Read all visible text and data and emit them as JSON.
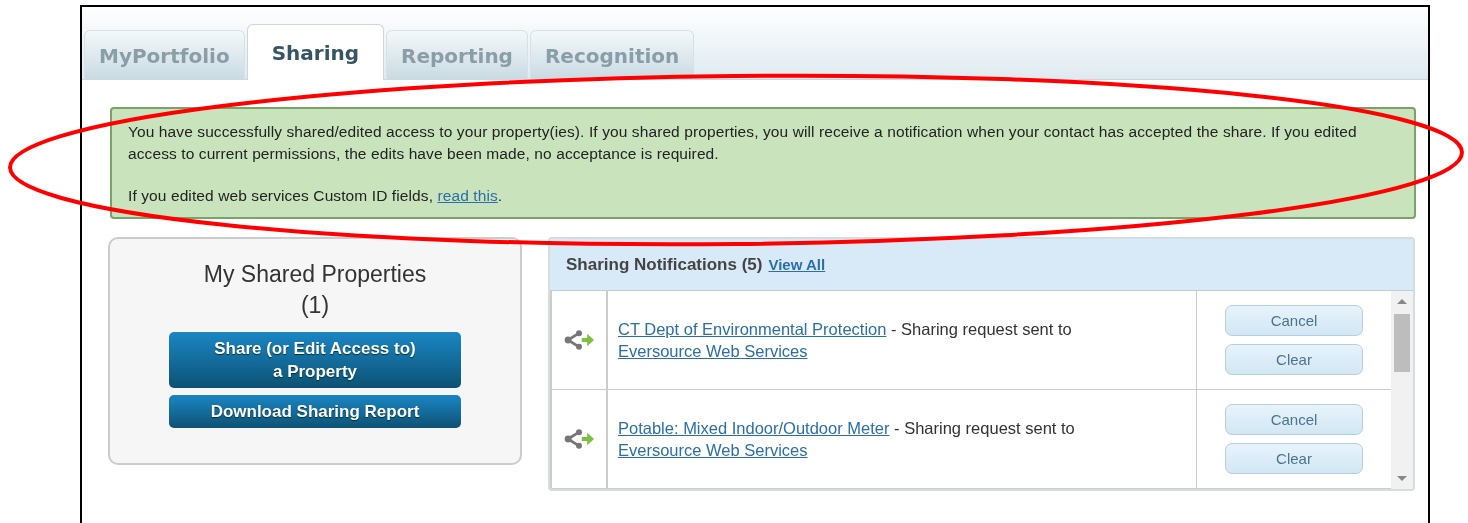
{
  "tabs": [
    {
      "label": "MyPortfolio",
      "selected": false
    },
    {
      "label": "Sharing",
      "selected": true
    },
    {
      "label": "Reporting",
      "selected": false
    },
    {
      "label": "Recognition",
      "selected": false
    }
  ],
  "alert": {
    "message": "You have successfully shared/edited access to your property(ies). If you shared properties, you will receive a notification when your contact has accepted the share. If you edited access to current permissions, the edits have been made, no acceptance is required.",
    "note_before": "If you edited web services Custom ID fields,",
    "note_link": "read this",
    "note_after": "."
  },
  "shared_properties": {
    "title": "My Shared Properties",
    "count": "(1)",
    "buttons": [
      {
        "line1": "Share (or Edit Access to)",
        "line2": "a Property"
      },
      {
        "line1": "Download Sharing Report"
      }
    ]
  },
  "notifications": {
    "title": "Sharing Notifications (5)",
    "view_all": "View All",
    "rows": [
      {
        "property": "CT Dept of Environmental Protection",
        "text": "- Sharing request sent to",
        "contact": "Eversource Web Services",
        "buttons": [
          "Cancel",
          "Clear"
        ]
      },
      {
        "property": "Potable: Mixed Indoor/Outdoor Meter",
        "text": "- Sharing request sent to",
        "contact": "Eversource Web Services",
        "buttons": [
          "Cancel",
          "Clear"
        ]
      }
    ]
  }
}
